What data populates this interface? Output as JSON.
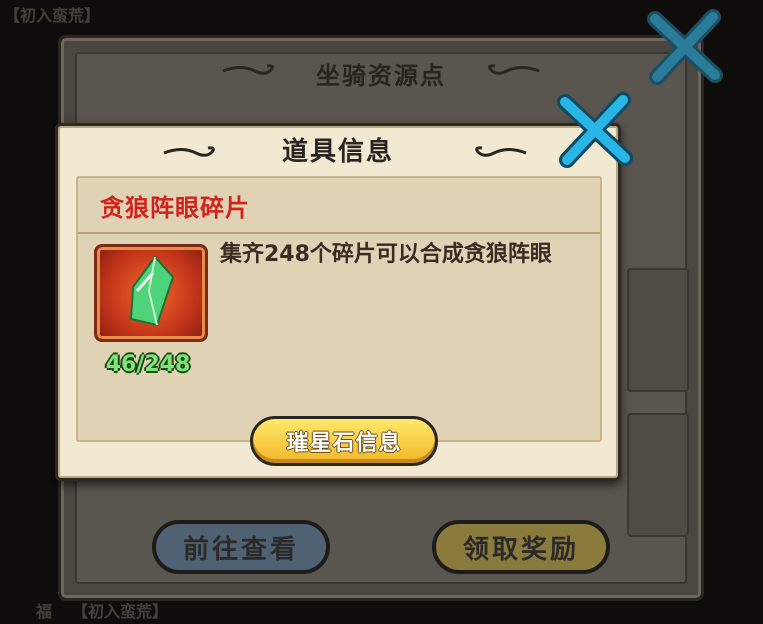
{
  "background": {
    "top_left_label": "【初入蛮荒】",
    "bottom_left_label": "【初入蛮荒】",
    "bottom_left_prefix": "福"
  },
  "back_panel": {
    "title": "坐骑资源点",
    "goto_button": "前往查看",
    "claim_button": "领取奖励"
  },
  "dialog": {
    "title": "道具信息",
    "item_name": "贪狼阵眼碎片",
    "item_description": "集齐248个碎片可以合成贪狼阵眼",
    "item_count": "46/248",
    "info_button": "璀星石信息"
  },
  "colors": {
    "item_name": "#d0231b",
    "count": "#7ee37a",
    "close_icon": "#29b6e6"
  },
  "icons": {
    "close": "close-icon",
    "item": "green-crystal-icon"
  }
}
